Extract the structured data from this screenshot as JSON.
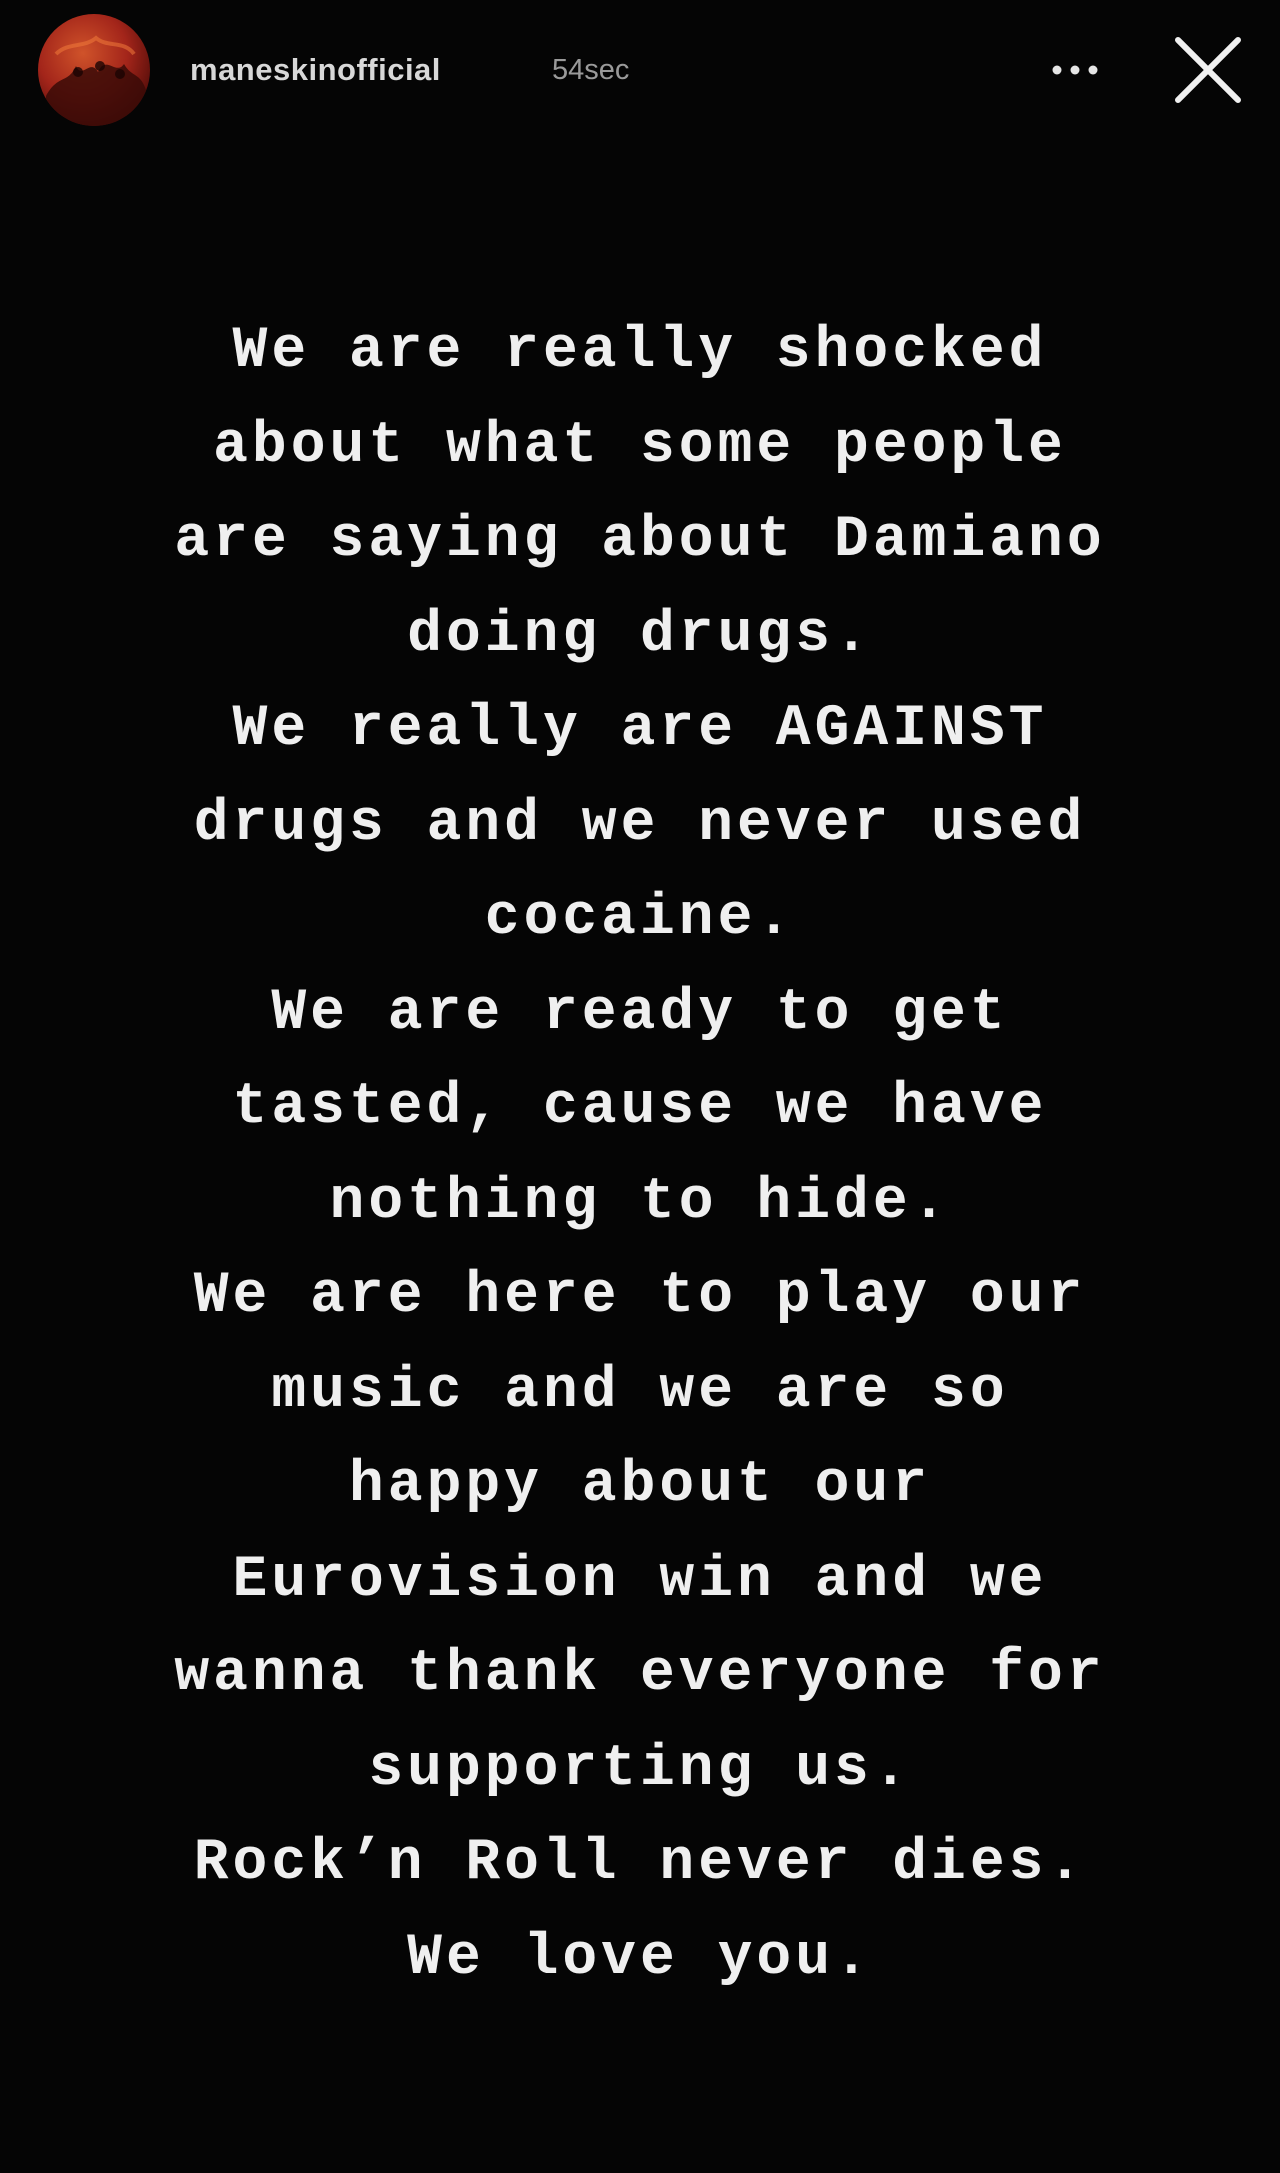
{
  "story": {
    "username": "maneskinofficial",
    "timestamp": "54sec",
    "avatar_icon": "profile-picture",
    "more_icon": "more-dots-icon",
    "close_icon": "close-icon",
    "text_color": "#efefef",
    "background_color": "#050505",
    "message_lines": [
      "We are really shocked",
      "about what some people",
      "are saying about Damiano",
      "doing drugs.",
      "We really are AGAINST",
      "drugs and we never used",
      "cocaine.",
      "We are ready to get",
      "tasted, cause we have",
      "nothing to hide.",
      "We are here to play our",
      "music and we are so",
      "happy about our",
      "Eurovision win and we",
      "wanna thank everyone for",
      "supporting us.",
      "Rock’n Roll never dies.",
      "We love you."
    ]
  }
}
